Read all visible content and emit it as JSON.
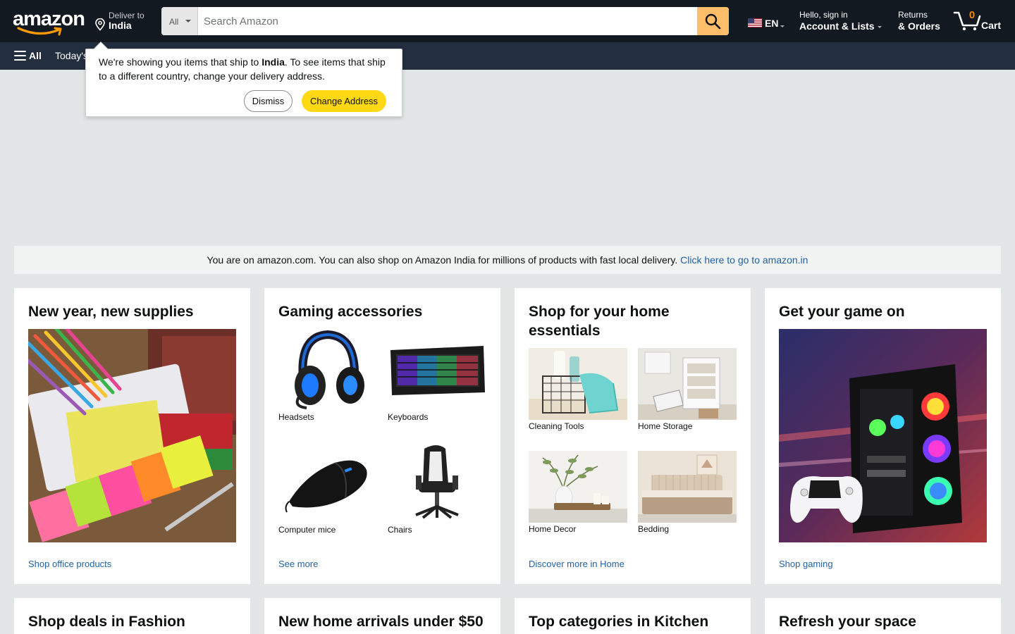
{
  "colors": {
    "nav_bg": "#131921",
    "subnav_bg": "#232f3e",
    "search_button": "#febd69",
    "primary_button": "#ffd814",
    "link": "#2162a1",
    "cart_count": "#f08804"
  },
  "header": {
    "logo_text": "amazon",
    "deliver_line1": "Deliver to",
    "deliver_line2": "India",
    "search_category": "All",
    "search_placeholder": "Search Amazon",
    "language": "EN",
    "account_line1": "Hello, sign in",
    "account_line2": "Account & Lists",
    "returns_line1": "Returns",
    "returns_line2": "& Orders",
    "cart_count": "0",
    "cart_label": "Cart"
  },
  "subnav": {
    "all_label": "All",
    "item1": "Today's"
  },
  "popover": {
    "text_before": "We're showing you items that ship to ",
    "country": "India",
    "text_after": ". To see items that ship to a different country, change your delivery address.",
    "dismiss_label": "Dismiss",
    "change_label": "Change Address"
  },
  "notice": {
    "text": "You are on amazon.com. You can also shop on Amazon India for millions of products with fast local delivery.",
    "link": "Click here to go to amazon.in"
  },
  "cards": [
    {
      "title": "New year, new supplies",
      "link": "Shop office products"
    },
    {
      "title": "Gaming accessories",
      "link": "See more",
      "tiles": [
        "Headsets",
        "Keyboards",
        "Computer mice",
        "Chairs"
      ]
    },
    {
      "title": "Shop for your home essentials",
      "link": "Discover more in Home",
      "tiles": [
        "Cleaning Tools",
        "Home Storage",
        "Home Decor",
        "Bedding"
      ]
    },
    {
      "title": "Get your game on",
      "link": "Shop gaming"
    }
  ],
  "bottom_cards": [
    "Shop deals in Fashion",
    "New home arrivals under $50",
    "Top categories in Kitchen",
    "Refresh your space"
  ]
}
